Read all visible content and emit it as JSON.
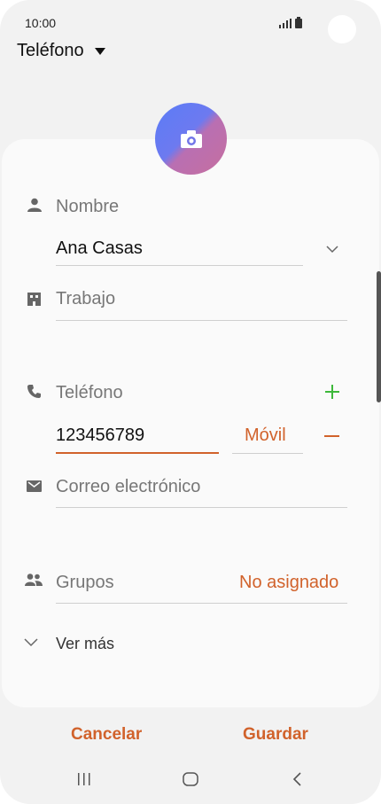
{
  "status_bar": {
    "time": "10:00"
  },
  "header": {
    "storage_label": "Teléfono"
  },
  "form": {
    "name_label": "Nombre",
    "name_value": "Ana Casas",
    "work_label": "Trabajo",
    "phone_label": "Teléfono",
    "phone_value": "123456789",
    "phone_type": "Móvil",
    "email_label": "Correo electrónico",
    "groups_label": "Grupos",
    "groups_value": "No asignado",
    "more_label": "Ver más"
  },
  "footer": {
    "cancel_label": "Cancelar",
    "save_label": "Guardar"
  },
  "colors": {
    "accent": "#d1622b",
    "add_green": "#3db83a"
  }
}
